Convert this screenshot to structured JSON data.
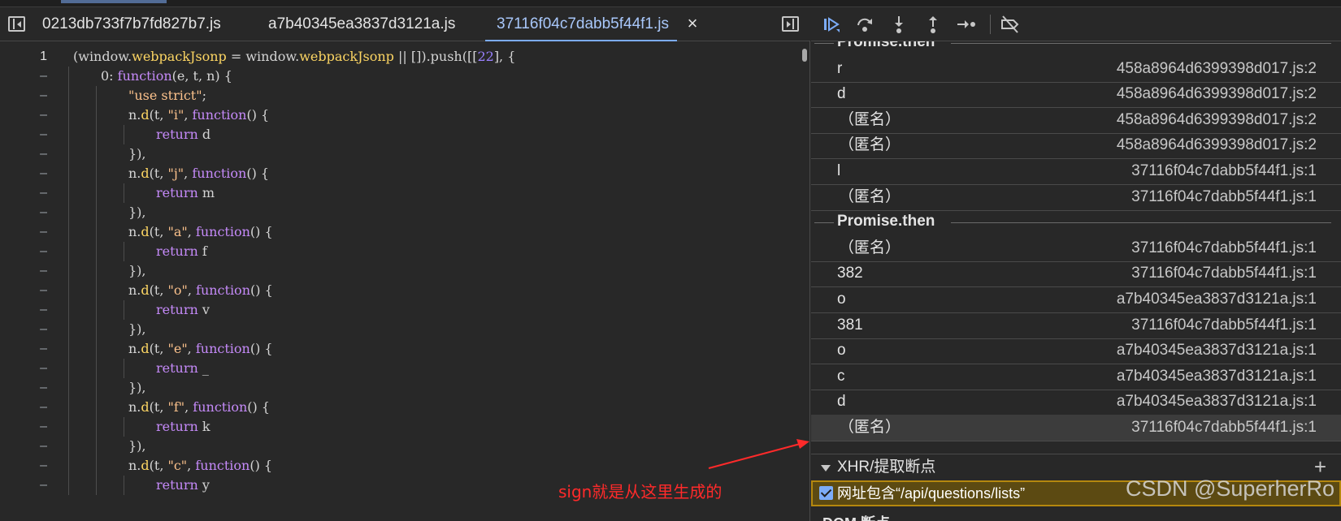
{
  "editor": {
    "tabs": [
      {
        "label": "0213db733f7b7fd827b7.js"
      },
      {
        "label": "a7b40345ea3837d3121a.js"
      },
      {
        "label": "37116f04c7dabb5f44f1.js"
      }
    ],
    "tab_close": "×",
    "line_numbers": [
      "1",
      "–",
      "–",
      "–",
      "–",
      "–",
      "–",
      "–",
      "–",
      "–",
      "–",
      "–",
      "–",
      "–",
      "–",
      "–",
      "–",
      "–",
      "–",
      "–",
      "–",
      "–",
      "–",
      "–",
      "–"
    ],
    "code_lines": [
      [
        [
          "",
          "(window."
        ],
        [
          "prop",
          "webpackJsonp"
        ],
        [
          "",
          " = window."
        ],
        [
          "prop",
          "webpackJsonp"
        ],
        [
          "",
          " || []).push([["
        ],
        [
          "num",
          "22"
        ],
        [
          "",
          "], {"
        ]
      ],
      [
        [
          "",
          "0: "
        ],
        [
          "fn",
          "function"
        ],
        [
          "",
          "(e, t, n) {"
        ]
      ],
      [
        [
          "str",
          "\"use strict\""
        ],
        [
          "",
          ";"
        ]
      ],
      [
        [
          "",
          "n."
        ],
        [
          "prop",
          "d"
        ],
        [
          "",
          "(t, "
        ],
        [
          "str",
          "\"i\""
        ],
        [
          "",
          ", "
        ],
        [
          "fn",
          "function"
        ],
        [
          "",
          "() {"
        ]
      ],
      [
        [
          "fn",
          "return"
        ],
        [
          "",
          " d"
        ]
      ],
      [
        [
          "",
          "}),"
        ]
      ],
      [
        [
          "",
          "n."
        ],
        [
          "prop",
          "d"
        ],
        [
          "",
          "(t, "
        ],
        [
          "str",
          "\"j\""
        ],
        [
          "",
          ", "
        ],
        [
          "fn",
          "function"
        ],
        [
          "",
          "() {"
        ]
      ],
      [
        [
          "fn",
          "return"
        ],
        [
          "",
          " m"
        ]
      ],
      [
        [
          "",
          "}),"
        ]
      ],
      [
        [
          "",
          "n."
        ],
        [
          "prop",
          "d"
        ],
        [
          "",
          "(t, "
        ],
        [
          "str",
          "\"a\""
        ],
        [
          "",
          ", "
        ],
        [
          "fn",
          "function"
        ],
        [
          "",
          "() {"
        ]
      ],
      [
        [
          "fn",
          "return"
        ],
        [
          "",
          " f"
        ]
      ],
      [
        [
          "",
          "}),"
        ]
      ],
      [
        [
          "",
          "n."
        ],
        [
          "prop",
          "d"
        ],
        [
          "",
          "(t, "
        ],
        [
          "str",
          "\"o\""
        ],
        [
          "",
          ", "
        ],
        [
          "fn",
          "function"
        ],
        [
          "",
          "() {"
        ]
      ],
      [
        [
          "fn",
          "return"
        ],
        [
          "",
          " v"
        ]
      ],
      [
        [
          "",
          "}),"
        ]
      ],
      [
        [
          "",
          "n."
        ],
        [
          "prop",
          "d"
        ],
        [
          "",
          "(t, "
        ],
        [
          "str",
          "\"e\""
        ],
        [
          "",
          ", "
        ],
        [
          "fn",
          "function"
        ],
        [
          "",
          "() {"
        ]
      ],
      [
        [
          "fn",
          "return"
        ],
        [
          "",
          " _"
        ]
      ],
      [
        [
          "",
          "}),"
        ]
      ],
      [
        [
          "",
          "n."
        ],
        [
          "prop",
          "d"
        ],
        [
          "",
          "(t, "
        ],
        [
          "str",
          "\"f\""
        ],
        [
          "",
          ", "
        ],
        [
          "fn",
          "function"
        ],
        [
          "",
          "() {"
        ]
      ],
      [
        [
          "fn",
          "return"
        ],
        [
          "",
          " k"
        ]
      ],
      [
        [
          "",
          "}),"
        ]
      ],
      [
        [
          "",
          "n."
        ],
        [
          "prop",
          "d"
        ],
        [
          "",
          "(t, "
        ],
        [
          "str",
          "\"c\""
        ],
        [
          "",
          ", "
        ],
        [
          "fn",
          "function"
        ],
        [
          "",
          "() {"
        ]
      ],
      [
        [
          "fn",
          "return"
        ],
        [
          "",
          " y"
        ]
      ]
    ]
  },
  "annotation": "sign就是从这里生成的",
  "debugger": {
    "toolbar": {
      "resume": "resume-icon",
      "step_over": "step-over-icon",
      "step_into": "step-into-icon",
      "step_out": "step-out-icon",
      "step": "step-icon",
      "deactivate": "deactivate-breakpoints-icon"
    },
    "call_stack": [
      {
        "kind": "async",
        "label": "Promise.then"
      },
      {
        "kind": "frame",
        "name": "r",
        "location": "458a8964d6399398d017.js:2"
      },
      {
        "kind": "frame",
        "name": "d",
        "location": "458a8964d6399398d017.js:2"
      },
      {
        "kind": "frame",
        "name": "（匿名）",
        "location": "458a8964d6399398d017.js:2"
      },
      {
        "kind": "frame",
        "name": "（匿名）",
        "location": "458a8964d6399398d017.js:2"
      },
      {
        "kind": "frame",
        "name": "l",
        "location": "37116f04c7dabb5f44f1.js:1"
      },
      {
        "kind": "frame",
        "name": "（匿名）",
        "location": "37116f04c7dabb5f44f1.js:1"
      },
      {
        "kind": "async",
        "label": "Promise.then"
      },
      {
        "kind": "frame",
        "name": "（匿名）",
        "location": "37116f04c7dabb5f44f1.js:1"
      },
      {
        "kind": "frame",
        "name": "382",
        "location": "37116f04c7dabb5f44f1.js:1"
      },
      {
        "kind": "frame",
        "name": "o",
        "location": "a7b40345ea3837d3121a.js:1"
      },
      {
        "kind": "frame",
        "name": "381",
        "location": "37116f04c7dabb5f44f1.js:1"
      },
      {
        "kind": "frame",
        "name": "o",
        "location": "a7b40345ea3837d3121a.js:1"
      },
      {
        "kind": "frame",
        "name": "c",
        "location": "a7b40345ea3837d3121a.js:1"
      },
      {
        "kind": "frame",
        "name": "d",
        "location": "a7b40345ea3837d3121a.js:1"
      },
      {
        "kind": "frame",
        "name": "（匿名）",
        "location": "37116f04c7dabb5f44f1.js:1",
        "selected": true
      }
    ],
    "xhr_section": {
      "title": "XHR/提取断点",
      "add": "+",
      "breakpoint_label": "网址包含“/api/questions/lists”",
      "checked": true
    },
    "next_section": "DOM 断点"
  },
  "watermark": "CSDN @SuperherRo"
}
